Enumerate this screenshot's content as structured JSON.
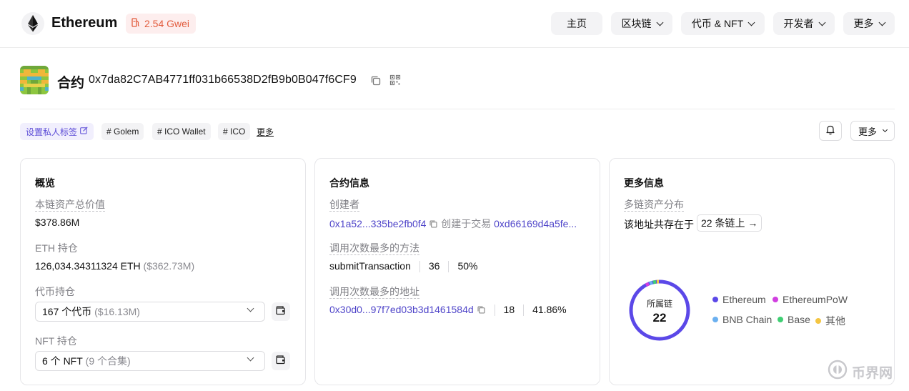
{
  "header": {
    "brand": "Ethereum",
    "gas": "2.54 Gwei",
    "nav": [
      {
        "label": "主页"
      },
      {
        "label": "区块链"
      },
      {
        "label": "代币 & NFT"
      },
      {
        "label": "开发者"
      },
      {
        "label": "更多"
      }
    ]
  },
  "contract": {
    "title": "合约",
    "address": "0x7da82C7AB4771ff031b66538D2fB9b0B047f6CF9"
  },
  "tags": {
    "private_label": "设置私人标签",
    "items": [
      "# Golem",
      "# ICO Wallet",
      "# ICO"
    ],
    "more": "更多"
  },
  "actions": {
    "more_button": "更多"
  },
  "overview": {
    "title": "概览",
    "total_value_label": "本链资产总价值",
    "total_value": "$378.86M",
    "eth_label": "ETH 持仓",
    "eth_amount": "126,034.34311324 ETH",
    "eth_usd": "($362.73M)",
    "token_label": "代币持仓",
    "token_select": "167 个代币",
    "token_select_usd": "($16.13M)",
    "nft_label": "NFT 持仓",
    "nft_select": "6 个 NFT",
    "nft_select_sub": "(9 个合集)"
  },
  "contract_info": {
    "title": "合约信息",
    "creator_label": "创建者",
    "creator_addr": "0x1a52...335be2fb0f4",
    "created_in": "创建于交易",
    "tx_hash": "0xd66169d4a5fe...",
    "method_label": "调用次数最多的方法",
    "method_name": "submitTransaction",
    "method_count": "36",
    "method_pct": "50%",
    "addr_label": "调用次数最多的地址",
    "top_addr": "0x30d0...97f7ed03b3d1461584d",
    "top_addr_count": "18",
    "top_addr_pct": "41.86%"
  },
  "more_info": {
    "title": "更多信息",
    "multichain_label": "多链资产分布",
    "exists_text": "该地址共存在于",
    "chains_chip": "22 条链上 →",
    "donut_label": "所属链",
    "donut_value": "22",
    "legend": [
      {
        "name": "Ethereum",
        "color": "#5b48e8"
      },
      {
        "name": "EthereumPoW",
        "color": "#d13fe0"
      },
      {
        "name": "BNB Chain",
        "color": "#6bb0f0"
      },
      {
        "name": "Base",
        "color": "#3fcf73"
      },
      {
        "name": "其他",
        "color": "#f4c542"
      }
    ]
  },
  "watermark": "币界网"
}
